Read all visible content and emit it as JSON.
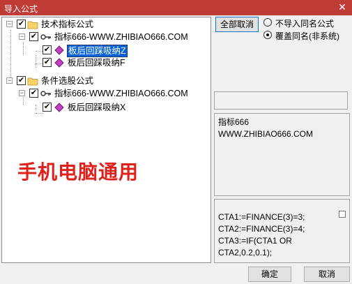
{
  "window": {
    "title": "导入公式",
    "close_glyph": "✕"
  },
  "tree": {
    "groups": [
      {
        "label": "技术指标公式",
        "formula_set": "指标666-WWW.ZHIBIAO666.COM",
        "items": [
          "板后回踩吸纳Z",
          "板后回踩吸纳F"
        ]
      },
      {
        "label": "条件选股公式",
        "formula_set": "指标666-WWW.ZHIBIAO666.COM",
        "items": [
          "板后回踩吸纳X"
        ]
      }
    ],
    "check_glyph": "✔",
    "collapse_glyph": "−"
  },
  "watermark": "手机电脑通用",
  "options": {
    "cancel_all_label": "全部取消",
    "radio_no_import": "不导入同名公式",
    "radio_overwrite": "覆盖同名(非系统)",
    "selected": "overwrite"
  },
  "info_panel": {
    "line1": "指标666",
    "line2": "WWW.ZHIBIAO666.COM"
  },
  "code_panel": {
    "lines": [
      "CTA1:=FINANCE(3)=3;",
      "CTA2:=FINANCE(3)=4;",
      "CTA3:=IF(CTA1 OR",
      "CTA2,0.2,0.1);"
    ]
  },
  "buttons": {
    "ok": "确定",
    "cancel": "取消"
  },
  "colors": {
    "titlebar": "#bf3b35",
    "selection": "#0a64d6",
    "watermark": "#e0201a"
  }
}
